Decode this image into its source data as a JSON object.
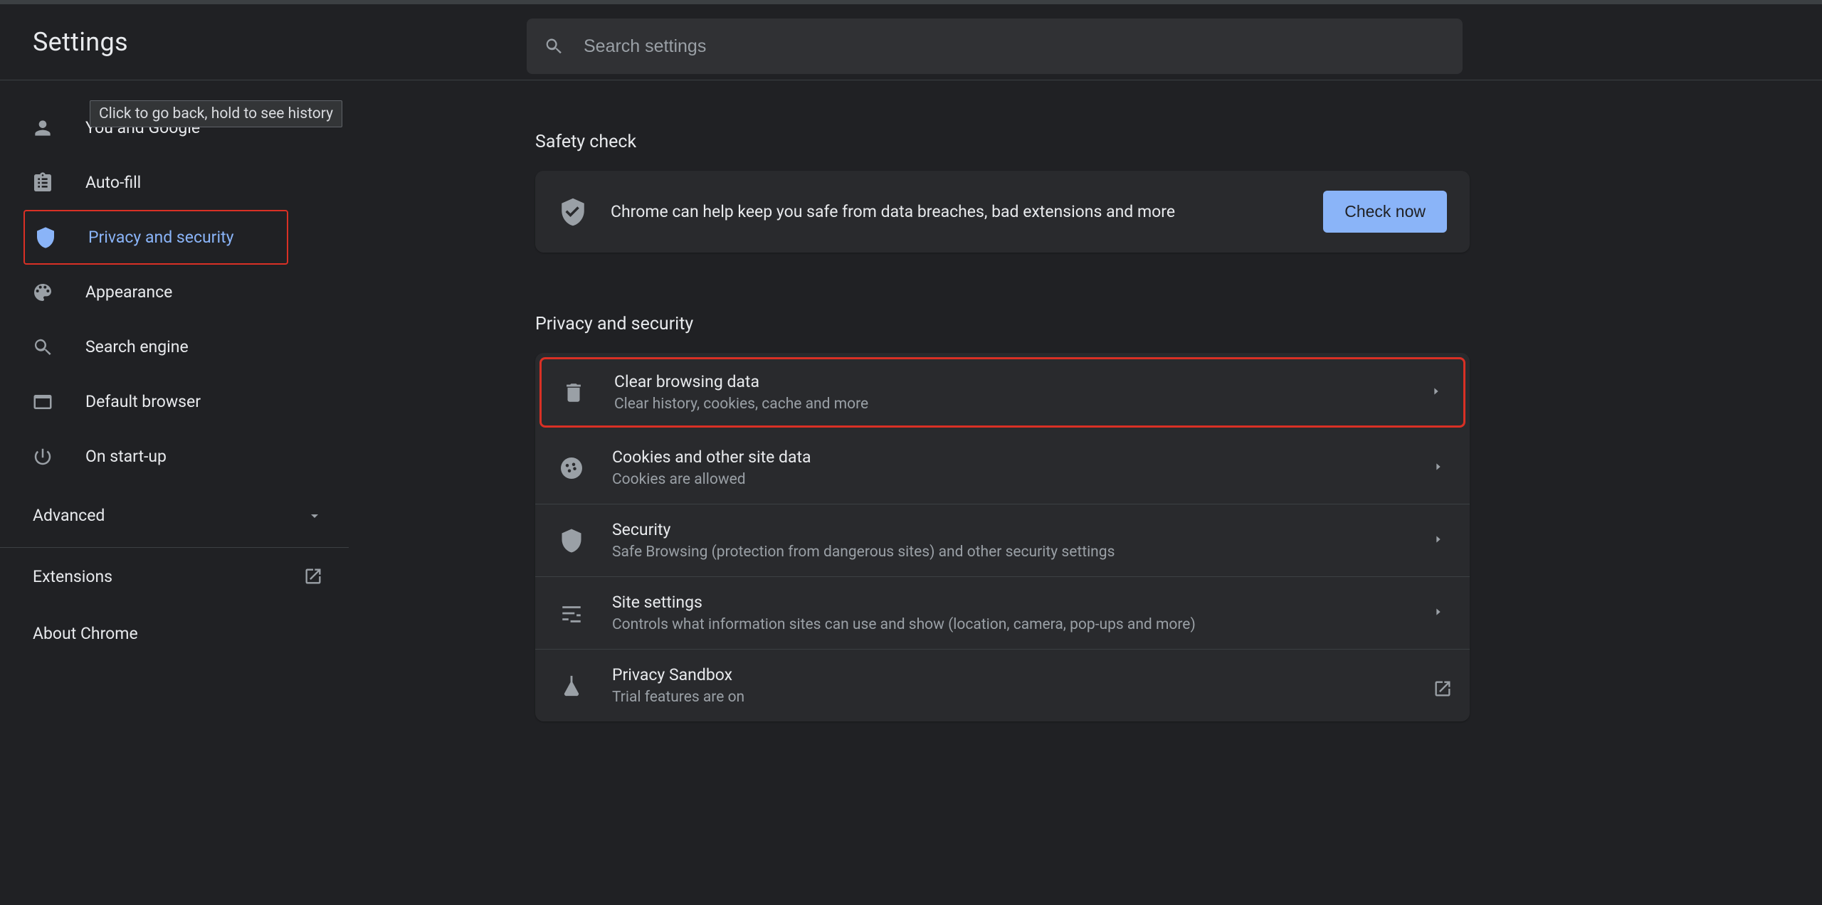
{
  "header": {
    "title": "Settings"
  },
  "search": {
    "placeholder": "Search settings"
  },
  "tooltip": "Click to go back, hold to see history",
  "sidebar": {
    "items": [
      {
        "label": "You and Google"
      },
      {
        "label": "Auto-fill"
      },
      {
        "label": "Privacy and security"
      },
      {
        "label": "Appearance"
      },
      {
        "label": "Search engine"
      },
      {
        "label": "Default browser"
      },
      {
        "label": "On start-up"
      }
    ],
    "advanced_label": "Advanced",
    "extensions_label": "Extensions",
    "about_label": "About Chrome"
  },
  "main": {
    "safety": {
      "heading": "Safety check",
      "text": "Chrome can help keep you safe from data breaches, bad extensions and more",
      "button": "Check now"
    },
    "privacy": {
      "heading": "Privacy and security",
      "rows": [
        {
          "title": "Clear browsing data",
          "sub": "Clear history, cookies, cache and more"
        },
        {
          "title": "Cookies and other site data",
          "sub": "Cookies are allowed"
        },
        {
          "title": "Security",
          "sub": "Safe Browsing (protection from dangerous sites) and other security settings"
        },
        {
          "title": "Site settings",
          "sub": "Controls what information sites can use and show (location, camera, pop-ups and more)"
        },
        {
          "title": "Privacy Sandbox",
          "sub": "Trial features are on"
        }
      ]
    }
  }
}
